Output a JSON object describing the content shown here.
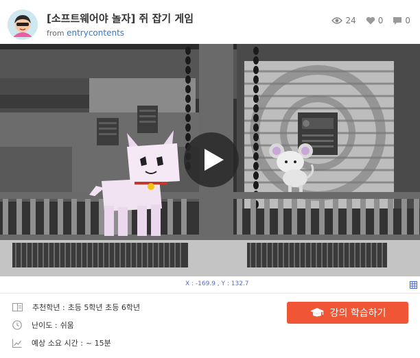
{
  "header": {
    "title": "[소프트웨어야 놀자] 쥐 잡기 게임",
    "from_prefix": "from",
    "author": "entrycontents",
    "stats": {
      "views": "24",
      "likes": "0",
      "comments": "0"
    }
  },
  "stage": {
    "coordinates": "X : -169.9 , Y : 132.7"
  },
  "info": {
    "grade_label": "추천학년 :",
    "grade_value": "초등 5학년 초등 6학년",
    "difficulty_label": "난이도 :",
    "difficulty_value": "쉬움",
    "time_label": "예상 소요 시간 :",
    "time_value": "~ 15분"
  },
  "actions": {
    "learn_label": "강의 학습하기"
  },
  "colors": {
    "accent": "#f05636",
    "link": "#3a76c4",
    "coordinate_text": "#4a6ad8"
  }
}
